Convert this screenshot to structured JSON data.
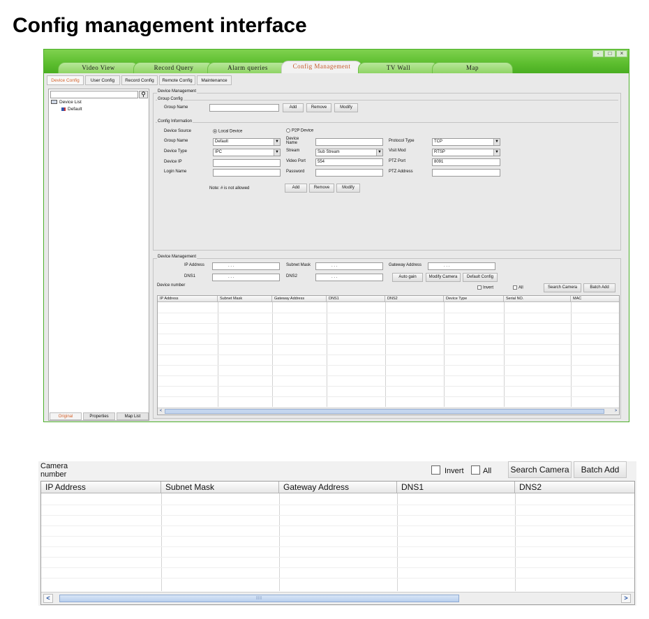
{
  "page_title": "Config management interface",
  "window": {
    "tabs": [
      "Video View",
      "Record Query",
      "Alarm queries",
      "Config Management",
      "TV Wall",
      "Map"
    ],
    "active_tab": "Config Management",
    "subtabs": [
      "Device Config",
      "User Config",
      "Record Config",
      "Remote Config",
      "Maintenance"
    ],
    "active_subtab": "Device Config",
    "controls": [
      "-",
      "□",
      "×"
    ]
  },
  "left_pane": {
    "tree_root": "Device List",
    "tree_child": "Default",
    "bottom_tabs": [
      "Original",
      "Properties",
      "Map List"
    ]
  },
  "device_management": {
    "title": "Device Management",
    "group_config": {
      "title": "Group Config",
      "group_name_label": "Group Name",
      "group_name_value": "",
      "buttons": [
        "Add",
        "Remove",
        "Modify"
      ]
    },
    "config_information": {
      "title": "Config Information",
      "device_source_label": "Device Source",
      "local_device": "Local Device",
      "p2p_device": "P2P Device",
      "group_name_label": "Group Name",
      "group_name_value": "Default",
      "device_type_label": "Device Type",
      "device_type_value": "IPC",
      "device_ip_label": "Device IP",
      "login_name_label": "Login Name",
      "device_name_label": "Device Name",
      "stream_label": "Stream",
      "stream_value": "Sub Stream",
      "video_port_label": "Video Port",
      "video_port_value": "554",
      "password_label": "Password",
      "protocol_type_label": "Protocol Type",
      "protocol_type_value": "TCP",
      "visit_mod_label": "Visit Mod",
      "visit_mod_value": "RTSP",
      "ptz_port_label": "PTZ Port",
      "ptz_port_value": "8091",
      "ptz_address_label": "PTZ Address",
      "note": "Note: # is not allowed",
      "buttons": [
        "Add",
        "Remove",
        "Modify"
      ]
    }
  },
  "network_management": {
    "title": "Device Management",
    "ip_address_label": "IP Address",
    "subnet_mask_label": "Subnet Mask",
    "gateway_address_label": "Gateway Address",
    "dns1_label": "DNS1",
    "dns2_label": "DNS2",
    "ip_placeholder": ".       .       .",
    "buttons": [
      "Auto gain",
      "Modify Camera",
      "Default Config"
    ],
    "device_number_label": "Device number",
    "invert_label": "Invert",
    "all_label": "All",
    "search_camera": "Search Camera",
    "batch_add": "Batch Add",
    "columns": [
      "IP Address",
      "Subnet Mask",
      "Gateway Address",
      "DNS1",
      "DNS2",
      "Device Type",
      "Serial NO.",
      "MAC"
    ]
  },
  "zoom_panel": {
    "camera_number_label": "Camera number",
    "invert_label": "Invert",
    "all_label": "All",
    "search_camera": "Search Camera",
    "batch_add": "Batch Add",
    "columns": [
      "IP Address",
      "Subnet Mask",
      "Gateway Address",
      "DNS1",
      "DNS2"
    ],
    "scroll_grip": "III",
    "scroll_left": "<",
    "scroll_right": ">"
  }
}
